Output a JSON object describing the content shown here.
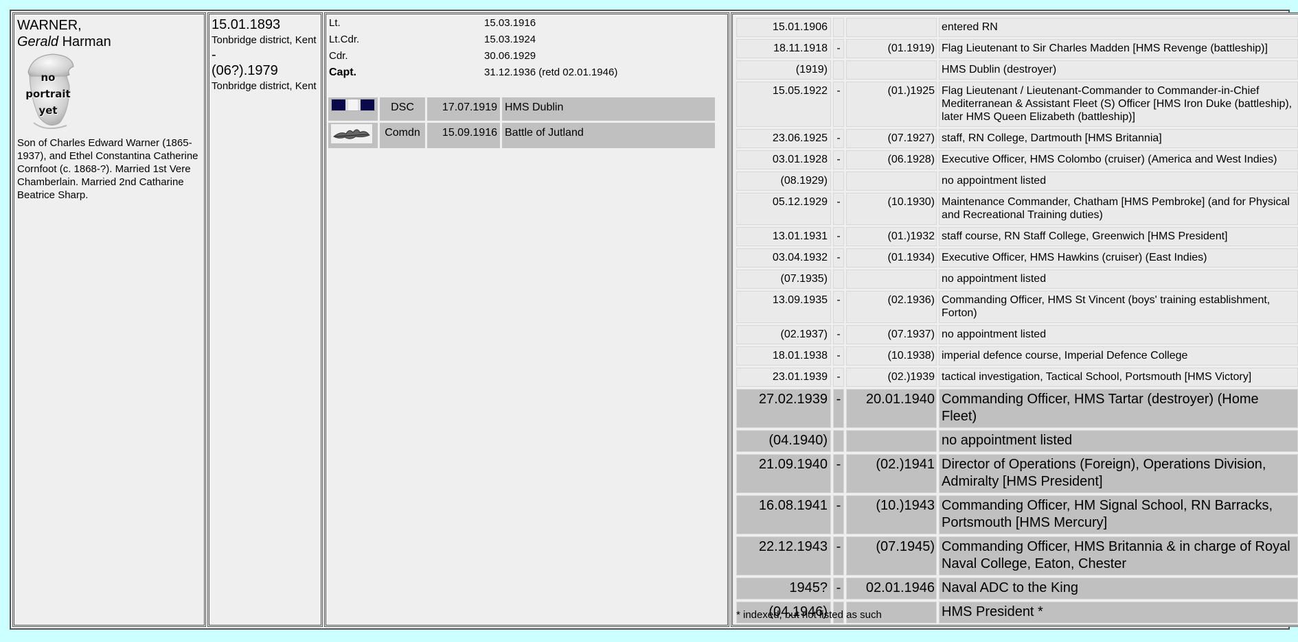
{
  "person": {
    "surname": "WARNER,",
    "given_italic": "Gerald",
    "given_rest": " Harman",
    "portrait_text": [
      "no",
      "portrait",
      "yet"
    ],
    "bio": "Son of Charles Edward Warner (1865-1937), and Ethel Constantina Catherine Cornfoot (c. 1868-?). Married 1st Vere Chamberlain. Married 2nd Catharine Beatrice Sharp."
  },
  "life": {
    "birth_date": "15.01.1893",
    "birth_place": "Tonbridge district, Kent",
    "dash": "-",
    "death_date": "(06?).1979",
    "death_place": "Tonbridge district, Kent"
  },
  "ranks": [
    {
      "rank": "Lt.",
      "date": "15.03.1916",
      "bold": false
    },
    {
      "rank": "Lt.Cdr.",
      "date": "15.03.1924",
      "bold": false
    },
    {
      "rank": "Cdr.",
      "date": "30.06.1929",
      "bold": false
    },
    {
      "rank": "Capt.",
      "date": "31.12.1936 (retd 02.01.1946)",
      "bold": true
    }
  ],
  "awards": [
    {
      "icon": "dsc-ribbon-icon",
      "abbr": "DSC",
      "date": "17.07.1919",
      "place": "HMS Dublin"
    },
    {
      "icon": "oak-leaf-icon",
      "abbr": "Comdn",
      "date": "15.09.1916",
      "place": "Battle of Jutland"
    }
  ],
  "career": [
    {
      "from": "15.01.1906",
      "sep": "",
      "to": "",
      "text": "entered RN",
      "big": false
    },
    {
      "from": "18.11.1918",
      "sep": "-",
      "to": "(01.1919)",
      "text": "Flag Lieutenant to Sir Charles Madden [HMS Revenge (battleship)]",
      "big": false
    },
    {
      "from": "(1919)",
      "sep": "",
      "to": "",
      "text": "HMS Dublin (destroyer)",
      "big": false
    },
    {
      "from": "15.05.1922",
      "sep": "-",
      "to": "(01.)1925",
      "text": "Flag Lieutenant / Lieutenant-Commander to Commander-in-Chief Mediterranean & Assistant Fleet (S) Officer [HMS Iron Duke (battleship), later HMS Queen Elizabeth (battleship)]",
      "big": false
    },
    {
      "from": "23.06.1925",
      "sep": "-",
      "to": "(07.1927)",
      "text": "staff, RN College, Dartmouth [HMS Britannia]",
      "big": false
    },
    {
      "from": "03.01.1928",
      "sep": "-",
      "to": "(06.1928)",
      "text": "Executive Officer, HMS Colombo (cruiser) (America and West Indies)",
      "big": false
    },
    {
      "from": "(08.1929)",
      "sep": "",
      "to": "",
      "text": "no appointment listed",
      "big": false
    },
    {
      "from": "05.12.1929",
      "sep": "-",
      "to": "(10.1930)",
      "text": "Maintenance Commander, Chatham [HMS Pembroke] (and for Physical and Recreational Training duties)",
      "big": false
    },
    {
      "from": "13.01.1931",
      "sep": "-",
      "to": "(01.)1932",
      "text": "staff course, RN Staff College, Greenwich [HMS President]",
      "big": false
    },
    {
      "from": "03.04.1932",
      "sep": "-",
      "to": "(01.1934)",
      "text": "Executive Officer, HMS Hawkins (cruiser) (East Indies)",
      "big": false
    },
    {
      "from": "(07.1935)",
      "sep": "",
      "to": "",
      "text": "no appointment listed",
      "big": false
    },
    {
      "from": "13.09.1935",
      "sep": "-",
      "to": "(02.1936)",
      "text": "Commanding Officer, HMS St Vincent (boys' training establishment, Forton)",
      "big": false
    },
    {
      "from": "(02.1937)",
      "sep": "-",
      "to": "(07.1937)",
      "text": "no appointment listed",
      "big": false
    },
    {
      "from": "18.01.1938",
      "sep": "-",
      "to": "(10.1938)",
      "text": "imperial defence course, Imperial Defence College",
      "big": false
    },
    {
      "from": "23.01.1939",
      "sep": "-",
      "to": "(02.)1939",
      "text": "tactical investigation, Tactical School, Portsmouth [HMS Victory]",
      "big": false
    },
    {
      "from": "27.02.1939",
      "sep": "-",
      "to": "20.01.1940",
      "text": "Commanding Officer, HMS Tartar (destroyer) (Home Fleet)",
      "big": true
    },
    {
      "from": "(04.1940)",
      "sep": "",
      "to": "",
      "text": "no appointment listed",
      "big": true
    },
    {
      "from": "21.09.1940",
      "sep": "-",
      "to": "(02.)1941",
      "text": "Director of Operations (Foreign), Operations Division, Admiralty [HMS President]",
      "big": true
    },
    {
      "from": "16.08.1941",
      "sep": "-",
      "to": "(10.)1943",
      "text": "Commanding Officer, HM Signal School, RN Barracks, Portsmouth [HMS Mercury]",
      "big": true
    },
    {
      "from": "22.12.1943",
      "sep": "-",
      "to": "(07.1945)",
      "text": "Commanding Officer, HMS Britannia & in charge of Royal Naval College, Eaton, Chester",
      "big": true
    },
    {
      "from": "1945?",
      "sep": "-",
      "to": "02.01.1946",
      "text": "Naval ADC to the King",
      "big": true
    },
    {
      "from": "(04.1946)",
      "sep": "",
      "to": "",
      "text": "HMS President *",
      "big": true
    }
  ],
  "footnote": "* indexed, but not listed as such"
}
